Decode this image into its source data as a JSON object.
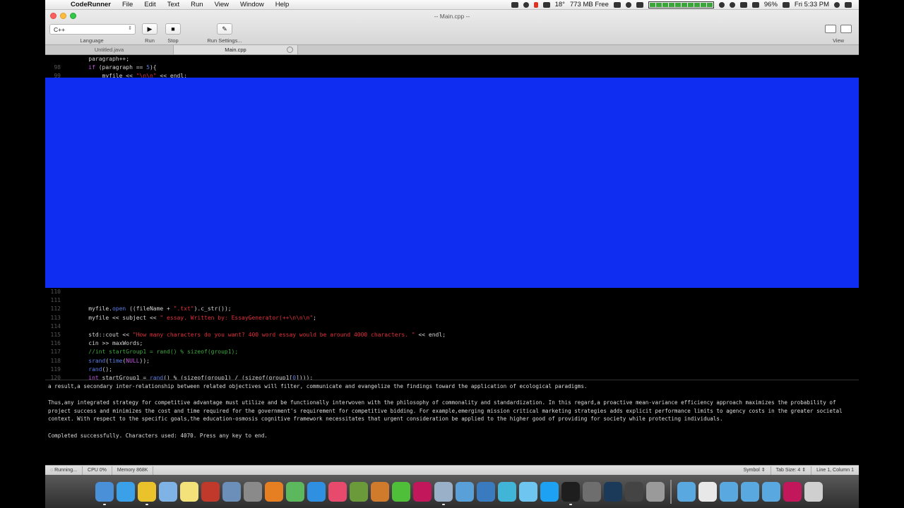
{
  "menubar": {
    "app": "CodeRunner",
    "menus": [
      "File",
      "Edit",
      "Text",
      "Run",
      "View",
      "Window",
      "Help"
    ],
    "temperature": "18°",
    "memory_free": "773 MB Free",
    "battery": "96%",
    "clock": "Fri 5:33 PM"
  },
  "window": {
    "title": "-- Main.cpp --"
  },
  "toolbar": {
    "language_value": "C++",
    "language_label": "Language",
    "run_label": "Run",
    "stop_label": "Stop",
    "settings_label": "Run Settings...",
    "view_label": "View"
  },
  "tabs": [
    {
      "label": "Untitled.java",
      "active": false
    },
    {
      "label": "Main.cpp",
      "active": true
    }
  ],
  "editor_top": [
    {
      "ln": "",
      "indent": "    ",
      "parts": [
        {
          "t": "paragraph++;",
          "c": ""
        }
      ]
    },
    {
      "ln": "98",
      "indent": "    ",
      "parts": [
        {
          "t": "if",
          "c": "kw"
        },
        {
          "t": " (paragraph == ",
          "c": ""
        },
        {
          "t": "5",
          "c": "fn"
        },
        {
          "t": "){",
          "c": ""
        }
      ]
    },
    {
      "ln": "99",
      "indent": "        ",
      "parts": [
        {
          "t": "myfile << ",
          "c": ""
        },
        {
          "t": "\"\\n\\n\"",
          "c": "str"
        },
        {
          "t": " << endl;",
          "c": ""
        }
      ]
    }
  ],
  "editor_bottom": [
    {
      "ln": "110",
      "indent": "",
      "parts": []
    },
    {
      "ln": "111",
      "indent": "",
      "parts": []
    },
    {
      "ln": "112",
      "indent": "    ",
      "parts": [
        {
          "t": "myfile.",
          "c": ""
        },
        {
          "t": "open",
          "c": "fn"
        },
        {
          "t": " ((fileName + ",
          "c": ""
        },
        {
          "t": "\".txt\"",
          "c": "str"
        },
        {
          "t": ").c_str());",
          "c": ""
        }
      ]
    },
    {
      "ln": "113",
      "indent": "    ",
      "parts": [
        {
          "t": "myfile << subject << ",
          "c": ""
        },
        {
          "t": "\" essay. Written by: EssayGenerator(++\\n\\n\\n\"",
          "c": "str"
        },
        {
          "t": ";",
          "c": ""
        }
      ]
    },
    {
      "ln": "114",
      "indent": "",
      "parts": []
    },
    {
      "ln": "115",
      "indent": "    ",
      "parts": [
        {
          "t": "std::cout << ",
          "c": ""
        },
        {
          "t": "\"How many characters do you want? 400 word essay would be around 4000 characters. \"",
          "c": "str"
        },
        {
          "t": " << endl;",
          "c": ""
        }
      ]
    },
    {
      "ln": "116",
      "indent": "    ",
      "parts": [
        {
          "t": "cin >> maxWords;",
          "c": ""
        }
      ]
    },
    {
      "ln": "117",
      "indent": "    ",
      "parts": [
        {
          "t": "//int startGroup1 = rand() % sizeof(group1);",
          "c": "cmt"
        }
      ]
    },
    {
      "ln": "118",
      "indent": "    ",
      "parts": [
        {
          "t": "srand",
          "c": "fn"
        },
        {
          "t": "(",
          "c": ""
        },
        {
          "t": "time",
          "c": "fn"
        },
        {
          "t": "(",
          "c": ""
        },
        {
          "t": "NULL",
          "c": "kw"
        },
        {
          "t": "));",
          "c": ""
        }
      ]
    },
    {
      "ln": "119",
      "indent": "    ",
      "parts": [
        {
          "t": "rand",
          "c": "fn"
        },
        {
          "t": "();",
          "c": ""
        }
      ]
    },
    {
      "ln": "120",
      "indent": "    ",
      "parts": [
        {
          "t": "int",
          "c": "kw"
        },
        {
          "t": " startGroup1 = ",
          "c": ""
        },
        {
          "t": "rand",
          "c": "fn"
        },
        {
          "t": "() % (sizeof(group1) / (sizeof(group1[",
          "c": ""
        },
        {
          "t": "0",
          "c": "fn"
        },
        {
          "t": "])));",
          "c": ""
        }
      ]
    }
  ],
  "console": {
    "line1": "a result,a secondary inter-relationship between related objectives will filter, communicate and evangelize the findings toward the application of ecological paradigms.",
    "line2": "Thus,any integrated strategy for competitive advantage must utilize and be functionally interwoven with the philosophy of commonality and standardization. In this regard,a proactive mean-variance efficiency approach maximizes the probability of project success and minimizes the cost and time required for the government's requirement for competitive bidding. For example,emerging mission critical marketing strategies adds explicit performance limits to agency costs in the greater societal context. With respect to the specific goals,the education-osmosis cognitive framework necessitates that urgent consideration be applied to the higher good of providing for society while protecting individuals.",
    "line3": "Completed successfully. Characters used: 4070. Press any key to end."
  },
  "statusbar": {
    "running": "Running...",
    "cpu": "CPU 0%",
    "memory": "Memory 868K",
    "symbol": "Symbol ⇕",
    "tab_size": "Tab Size: 4 ⇕",
    "position": "Line 1, Column 1"
  },
  "dock": {
    "icons": [
      {
        "name": "finder-icon",
        "color": "#4a90d9"
      },
      {
        "name": "safari-icon",
        "color": "#3aa0e8"
      },
      {
        "name": "chrome-icon",
        "color": "#e9c22c"
      },
      {
        "name": "preview-icon",
        "color": "#7fb3e6"
      },
      {
        "name": "notes-icon",
        "color": "#f3e27a"
      },
      {
        "name": "acrobat-icon",
        "color": "#c0392b"
      },
      {
        "name": "mail-icon",
        "color": "#6b8fb8"
      },
      {
        "name": "script-editor-icon",
        "color": "#8a8a8a"
      },
      {
        "name": "keynote-icon",
        "color": "#e67e22"
      },
      {
        "name": "numbers-icon",
        "color": "#5cb85c"
      },
      {
        "name": "app-store-icon",
        "color": "#2f8fe0"
      },
      {
        "name": "itunes-icon",
        "color": "#e84a6e"
      },
      {
        "name": "minecraft-icon",
        "color": "#6a9a3a"
      },
      {
        "name": "xcode-icon",
        "color": "#d07b2c"
      },
      {
        "name": "messages-icon",
        "color": "#4fbf3a"
      },
      {
        "name": "intellij-icon",
        "color": "#c2185b"
      },
      {
        "name": "system-utility-icon",
        "color": "#9ab0c8"
      },
      {
        "name": "photos-icon",
        "color": "#5aa0d8"
      },
      {
        "name": "vmware-icon",
        "color": "#3a7abf"
      },
      {
        "name": "network-icon",
        "color": "#40b5d8"
      },
      {
        "name": "chat-icon",
        "color": "#6ec6f0"
      },
      {
        "name": "skype-icon",
        "color": "#1da1f2"
      },
      {
        "name": "terminal-icon",
        "color": "#1e1e1e"
      },
      {
        "name": "system-preferences-icon",
        "color": "#6e6e6e"
      },
      {
        "name": "steam-icon",
        "color": "#1b3a5a"
      },
      {
        "name": "game-icon",
        "color": "#444444"
      },
      {
        "name": "disk-utility-icon",
        "color": "#9a9a9a"
      }
    ],
    "trailing": [
      {
        "name": "folder-icon",
        "color": "#5aa8e0"
      },
      {
        "name": "documents-icon",
        "color": "#e8e8e8"
      },
      {
        "name": "downloads-folder-icon",
        "color": "#5aa8e0"
      },
      {
        "name": "applications-folder-icon",
        "color": "#5aa8e0"
      },
      {
        "name": "stack-folder-icon",
        "color": "#5aa8e0"
      },
      {
        "name": "java-icon",
        "color": "#c2185b"
      },
      {
        "name": "trash-icon",
        "color": "#cfcfcf"
      }
    ]
  }
}
